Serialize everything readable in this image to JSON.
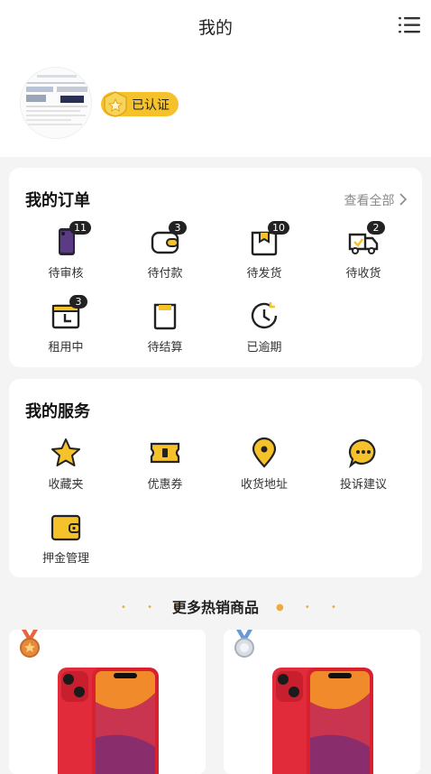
{
  "header": {
    "title": "我的"
  },
  "profile": {
    "verified_label": "已认证"
  },
  "orders": {
    "title": "我的订单",
    "view_all": "查看全部",
    "items": [
      {
        "label": "待审核",
        "count": "11",
        "icon": "phone-thumbnail-icon"
      },
      {
        "label": "待付款",
        "count": "3",
        "icon": "wallet-icon"
      },
      {
        "label": "待发货",
        "count": "10",
        "icon": "box-icon"
      },
      {
        "label": "待收货",
        "count": "2",
        "icon": "truck-icon"
      },
      {
        "label": "租用中",
        "count": "3",
        "icon": "calendar-clock-icon"
      },
      {
        "label": "待结算",
        "count": "",
        "icon": "document-icon"
      },
      {
        "label": "已逾期",
        "count": "",
        "icon": "clock-icon"
      }
    ]
  },
  "services": {
    "title": "我的服务",
    "items": [
      {
        "label": "收藏夹",
        "icon": "star-icon"
      },
      {
        "label": "优惠券",
        "icon": "coupon-icon"
      },
      {
        "label": "收货地址",
        "icon": "location-pin-icon"
      },
      {
        "label": "投诉建议",
        "icon": "chat-bubble-icon"
      },
      {
        "label": "押金管理",
        "icon": "wallet-icon"
      }
    ]
  },
  "more": {
    "title": "更多热销商品"
  },
  "colors": {
    "accent": "#f6c22b",
    "text": "#222222",
    "muted": "#8a8a8a",
    "bg": "#f4f4f4"
  }
}
